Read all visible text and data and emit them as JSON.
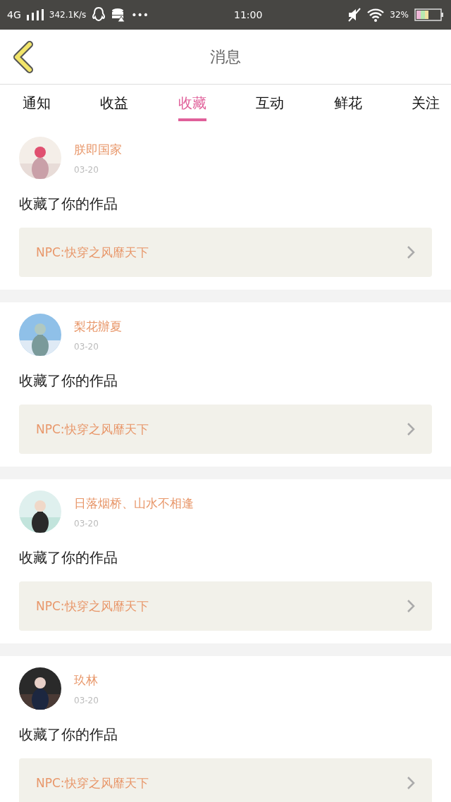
{
  "status_bar": {
    "network": "4G",
    "speed": "342.1K/s",
    "more": "•••",
    "time": "11:00",
    "battery": "32%"
  },
  "header": {
    "title": "消息"
  },
  "tabs": [
    {
      "label": "通知",
      "selected": false
    },
    {
      "label": "收益",
      "selected": false
    },
    {
      "label": "收藏",
      "selected": true
    },
    {
      "label": "互动",
      "selected": false
    },
    {
      "label": "鲜花",
      "selected": false
    },
    {
      "label": "关注",
      "selected": false
    }
  ],
  "messages": [
    {
      "name": "朕即国家",
      "date": "03-20",
      "text": "收藏了你的作品",
      "work": "NPC:快穿之风靡天下"
    },
    {
      "name": "梨花辦夏",
      "date": "03-20",
      "text": "收藏了你的作品",
      "work": "NPC:快穿之风靡天下"
    },
    {
      "name": "日落烟桥、山水不相逢",
      "date": "03-20",
      "text": "收藏了你的作品",
      "work": "NPC:快穿之风靡天下"
    },
    {
      "name": "玖林",
      "date": "03-20",
      "text": "收藏了你的作品",
      "work": "NPC:快穿之风靡天下"
    }
  ]
}
